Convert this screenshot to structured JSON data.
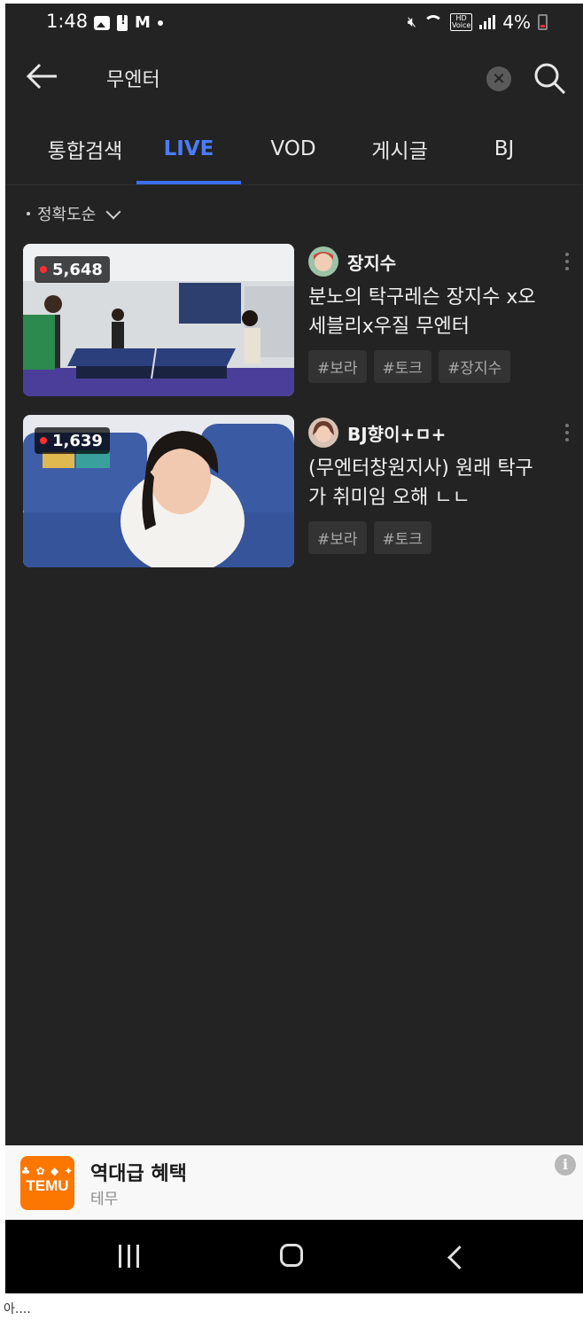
{
  "status_bar": {
    "time": "1:48",
    "battery": "4%"
  },
  "search": {
    "query": "무엔터"
  },
  "tabs": [
    {
      "label": "통합검색",
      "active": false
    },
    {
      "label": "LIVE",
      "active": true
    },
    {
      "label": "VOD",
      "active": false
    },
    {
      "label": "게시글",
      "active": false
    },
    {
      "label": "BJ",
      "active": false
    }
  ],
  "sort": {
    "label": "정확도순"
  },
  "streams": [
    {
      "viewers": "5,648",
      "streamer": "장지수",
      "title": "분노의 탁구레슨 장지수 x오세블리x우질 무엔터",
      "tags": [
        "#보라",
        "#토크",
        "#장지수"
      ]
    },
    {
      "viewers": "1,639",
      "streamer": "BJ향이+ㅁ+",
      "title": "(무엔터창원지사) 원래 탁구가 취미임 오해 ㄴㄴ",
      "tags": [
        "#보라",
        "#토크"
      ]
    }
  ],
  "ad": {
    "logo_text": "TEMU",
    "title": "역대급 혜택",
    "advertiser": "테무"
  },
  "caption": "아....",
  "colors": {
    "accent": "#3b6ff0",
    "background": "#232323",
    "live": "#ff2d2d",
    "ad_brand": "#fb7701"
  }
}
